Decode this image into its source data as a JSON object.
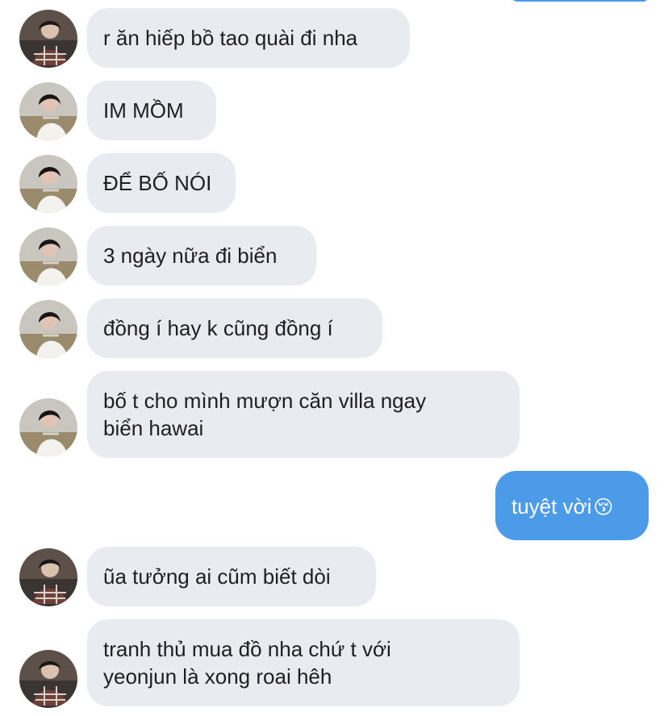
{
  "messages": [
    {
      "id": "m1",
      "direction": "incoming",
      "avatar": "avatar-friend",
      "lines": [
        "r ăn hiếp bồ tao quài đi nha"
      ]
    },
    {
      "id": "m2",
      "direction": "incoming",
      "avatar": "avatar-other",
      "lines": [
        "IM MỒM"
      ]
    },
    {
      "id": "m3",
      "direction": "incoming",
      "avatar": "avatar-other",
      "lines": [
        "ĐỂ BỐ NÓI"
      ]
    },
    {
      "id": "m4",
      "direction": "incoming",
      "avatar": "avatar-other",
      "lines": [
        "3 ngày nữa đi biển"
      ]
    },
    {
      "id": "m5",
      "direction": "incoming",
      "avatar": "avatar-other",
      "lines": [
        "đồng í hay k cũng đồng í"
      ]
    },
    {
      "id": "m6",
      "direction": "incoming",
      "avatar": "avatar-other",
      "lines": [
        " bố t cho mình mượn căn villa ngay",
        "biển hawai"
      ]
    },
    {
      "id": "m7",
      "direction": "outgoing",
      "lines": [
        "tuyệt vời"
      ],
      "emoji": "😚"
    },
    {
      "id": "m8",
      "direction": "incoming",
      "avatar": "avatar-friend",
      "lines": [
        "ũa tưởng ai cũm biết dòi"
      ]
    },
    {
      "id": "m9",
      "direction": "incoming",
      "avatar": "avatar-friend",
      "lines": [
        "tranh thủ mua đồ nha chứ t với",
        "yeonjun là xong roai hêh"
      ]
    }
  ],
  "colors": {
    "incoming_bubble": "#e8ebf0",
    "outgoing_bubble": "#4b9be8",
    "incoming_text": "#1f1f1f",
    "outgoing_text": "#ffffff"
  }
}
